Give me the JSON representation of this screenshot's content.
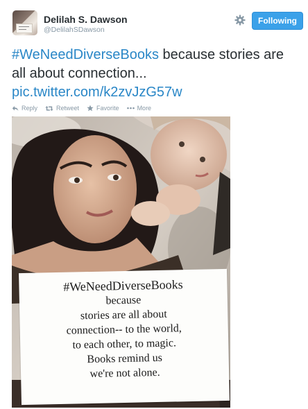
{
  "user": {
    "name": "Delilah S. Dawson",
    "handle": "@DelilahSDawson",
    "avatar_icon": "user-avatar"
  },
  "header": {
    "settings_icon": "gear-icon",
    "follow_label": "Following",
    "follow_color": "#3ba1e9"
  },
  "tweet": {
    "hashtag": "#WeNeedDiverseBooks",
    "text": " because stories are all about connection...",
    "link": "pic.twitter.com/k2zvJzG57w",
    "link_color": "#2a87c7"
  },
  "actions": [
    {
      "label": "Reply",
      "icon": "reply-icon"
    },
    {
      "label": "Retweet",
      "icon": "retweet-icon"
    },
    {
      "label": "Favorite",
      "icon": "star-icon"
    },
    {
      "label": "More",
      "icon": "more-dots-icon"
    }
  ],
  "photo": {
    "sign_lines": [
      "#WeNeedDiverseBooks",
      "because",
      "stories are all about",
      "connection-- to the world,",
      "to each other, to magic.",
      "Books remind us",
      "we're not alone."
    ]
  }
}
